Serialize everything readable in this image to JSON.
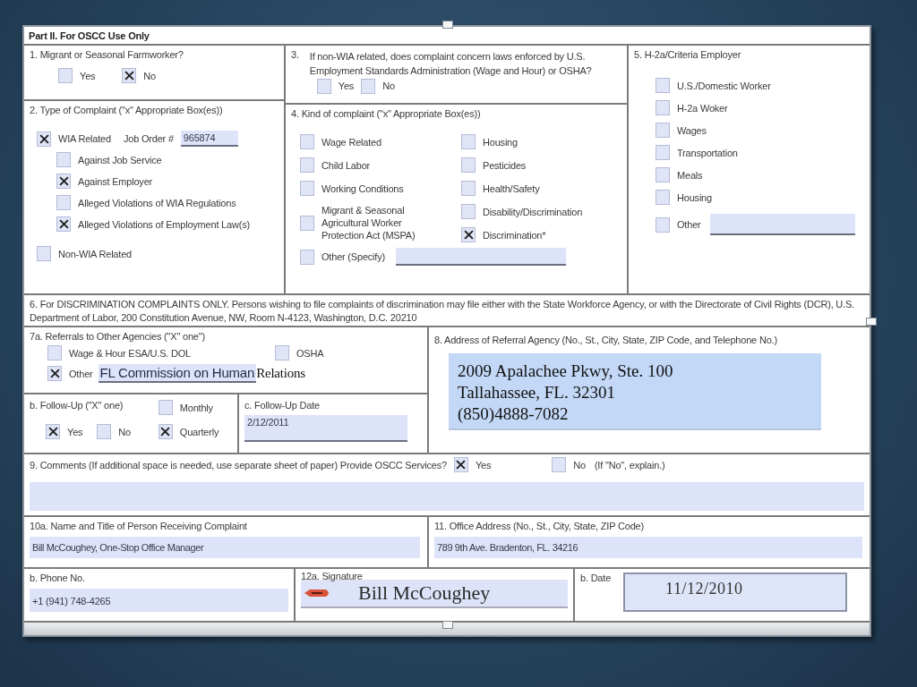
{
  "form_title": "Part II. For OSCC Use Only",
  "q1": {
    "label": "1. Migrant or Seasonal Farmworker?",
    "options": [
      {
        "label": "Yes",
        "checked": false
      },
      {
        "label": "No",
        "checked": true
      }
    ]
  },
  "q2": {
    "label": "2. Type of Complaint (\"x\" Appropriate Box(es))",
    "wia": {
      "label": "WIA Related",
      "checked": true
    },
    "job_order_label": "Job Order #",
    "job_order": "965874",
    "sub_options": [
      {
        "label": "Against Job Service",
        "checked": false
      },
      {
        "label": "Against Employer",
        "checked": true
      },
      {
        "label": "Alleged Violations of WIA Regulations",
        "checked": false
      },
      {
        "label": "Alleged Violations of Employment Law(s)",
        "checked": true
      }
    ],
    "non_wia": {
      "label": "Non-WIA Related",
      "checked": false
    }
  },
  "q3": {
    "number": "3.",
    "text": "If non-WIA related, does complaint concern laws enforced by U.S. Employment Standards Administration (Wage and Hour) or OSHA?",
    "options": [
      {
        "label": "Yes",
        "checked": false
      },
      {
        "label": "No",
        "checked": false
      }
    ]
  },
  "q4": {
    "label": "4. Kind of complaint (\"x\" Appropriate Box(es))",
    "column_1": [
      {
        "label": "Wage Related",
        "checked": false
      },
      {
        "label": "Child Labor",
        "checked": false
      },
      {
        "label": "Working Conditions",
        "checked": false
      },
      {
        "label": "Migrant & Seasonal Agricultural Worker Protection Act (MSPA)",
        "checked": false
      }
    ],
    "column_2": [
      {
        "label": "Housing",
        "checked": false
      },
      {
        "label": "Pesticides",
        "checked": false
      },
      {
        "label": "Health/Safety",
        "checked": false
      },
      {
        "label": "Disability/Discrimination",
        "checked": false
      },
      {
        "label": "Discrimination*",
        "checked": true
      }
    ],
    "other": {
      "label": "Other (Specify)",
      "checked": false
    }
  },
  "q5": {
    "label": "5. H-2a/Criteria Employer",
    "options": [
      {
        "label": "U.S./Domestic Worker",
        "checked": false
      },
      {
        "label": "H-2a Woker",
        "checked": false
      },
      {
        "label": "Wages",
        "checked": false
      },
      {
        "label": "Transportation",
        "checked": false
      },
      {
        "label": "Meals",
        "checked": false
      },
      {
        "label": "Housing",
        "checked": false
      }
    ],
    "other": {
      "label": "Other",
      "checked": false
    }
  },
  "q6": {
    "text": "6. For DISCRIMINATION COMPLAINTS ONLY. Persons wishing to file complaints of discrimination may file either with the State Workforce Agency, or with the Directorate of Civil Rights (DCR), U.S. Department of Labor, 200 Constitution Avenue, NW, Room N-4123, Washington, D.C. 20210"
  },
  "q7a": {
    "label": "7a. Referrals to Other Agencies (\"X\" one\")",
    "options": [
      {
        "label": "Wage & Hour ESA/U.S. DOL",
        "checked": false
      },
      {
        "label": "OSHA",
        "checked": false
      }
    ],
    "other": {
      "label": "Other",
      "checked": true,
      "value": "FL Commission on Human",
      "overflow_text": "Relations"
    }
  },
  "q7b": {
    "label": "b. Follow-Up (\"X\" one)",
    "options": [
      {
        "label": "Yes",
        "checked": true
      },
      {
        "label": "No",
        "checked": false
      }
    ],
    "frequency": [
      {
        "label": "Monthly",
        "checked": false
      },
      {
        "label": "Quarterly",
        "checked": true
      }
    ]
  },
  "q7c": {
    "label": "c.  Follow-Up Date",
    "value": "2/12/2011"
  },
  "q8": {
    "label": "8.  Address of Referral Agency (No., St., City, State, ZIP Code, and Telephone No.)",
    "lines": [
      "2009 Apalachee Pkwy, Ste. 100",
      "Tallahassee, FL. 32301",
      "(850)4888-7082"
    ]
  },
  "q9": {
    "label": "9. Comments (If additional space is needed, use separate sheet of paper)  Provide OSCC Services?",
    "options": [
      {
        "label": "Yes",
        "checked": true
      },
      {
        "label": "No",
        "checked": false
      }
    ],
    "note": "(If \"No\", explain.)"
  },
  "q10a": {
    "label": "10a.  Name and Title of Person Receiving Complaint",
    "value": "Bill McCoughey, One-Stop Office Manager"
  },
  "q11": {
    "label": "11.  Office Address (No., St., City, State, ZIP Code)",
    "value": "789 9th Ave. Bradenton, FL. 34216"
  },
  "q10b": {
    "label": "b. Phone No.",
    "value": "+1 (941) 748-4265"
  },
  "q12a": {
    "label": "12a. Signature",
    "value": "Bill McCoughey"
  },
  "q12b": {
    "label": "b. Date",
    "value": "11/12/2010"
  }
}
